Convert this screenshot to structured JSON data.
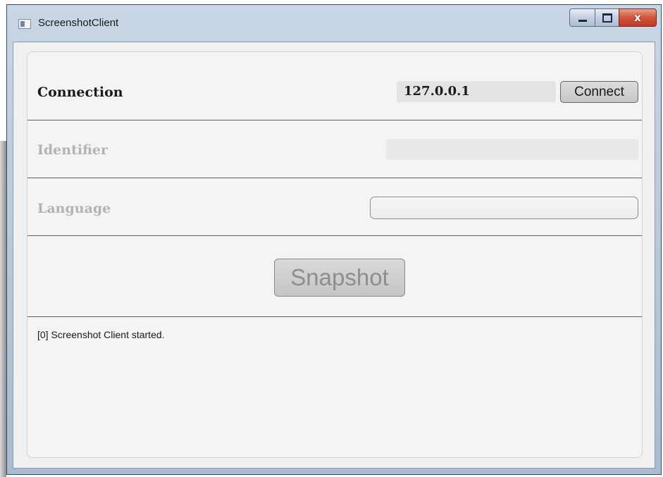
{
  "window": {
    "title": "ScreenshotClient",
    "close_glyph": "x"
  },
  "connection": {
    "label": "Connection",
    "ip_value": "127.0.0.1",
    "connect_label": "Connect"
  },
  "identifier": {
    "label": "Identifier",
    "value": ""
  },
  "language": {
    "label": "Language",
    "value": ""
  },
  "snapshot": {
    "label": "Snapshot"
  },
  "log": {
    "lines": [
      "[0] Screenshot Client started."
    ]
  },
  "icons": {
    "app": "app-window-icon",
    "minimize": "minimize-icon",
    "maximize": "maximize-icon",
    "close": "close-icon"
  },
  "colors": {
    "close_button": "#c0392b",
    "disabled_text": "#b3b3b3",
    "panel_background": "#f4f4f4"
  }
}
